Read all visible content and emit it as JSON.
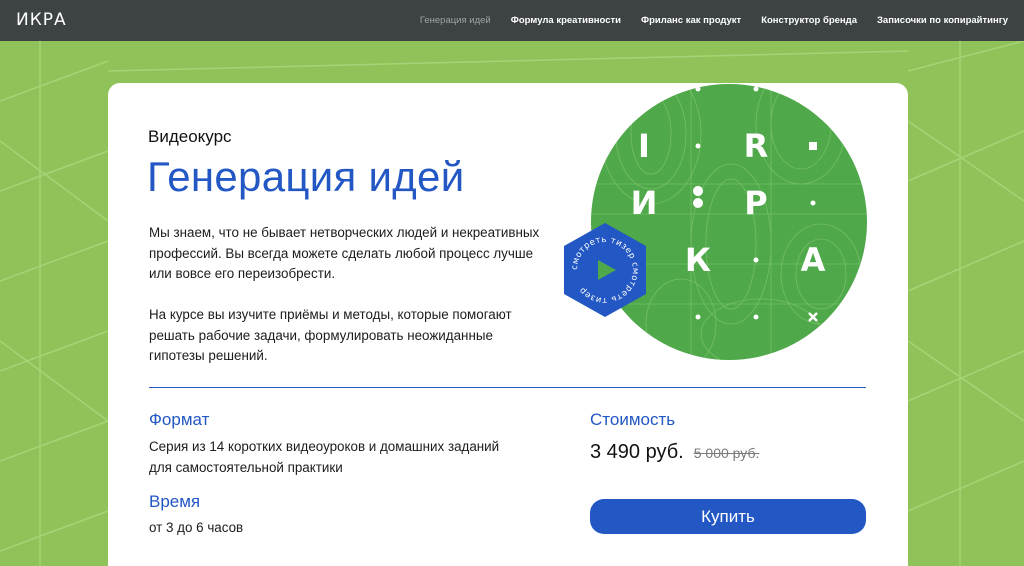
{
  "header": {
    "logo": "ИКРА",
    "nav": [
      {
        "label": "Генерация идей",
        "active": true
      },
      {
        "label": "Формула креативности",
        "active": false
      },
      {
        "label": "Фриланс как продукт",
        "active": false
      },
      {
        "label": "Конструктор бренда",
        "active": false
      },
      {
        "label": "Записочки по копирайтингу",
        "active": false
      }
    ]
  },
  "course": {
    "eyebrow": "Видеокурс",
    "title": "Генерация идей",
    "description_1": "Мы знаем, что не бывает нетворческих людей и некреативных профессий. Вы всегда можете сделать любой процесс лучше или вовсе его переизобрести.",
    "description_2": "На курсе вы изучите приёмы и методы, которые помогают решать рабочие задачи, формулировать неожиданные гипотезы решений."
  },
  "hero": {
    "letters": [
      "I",
      "R",
      "И",
      "Р",
      "К",
      "А"
    ],
    "teaser_label": "смотреть тизер смотреть тизер"
  },
  "details": {
    "format_title": "Формат",
    "format_text": "Серия из 14 коротких видеоуроков и домашних заданий для самостоятельной практики",
    "time_title": "Время",
    "time_text": "от 3 до 6 часов",
    "price_title": "Стоимость",
    "price_current": "3 490 руб.",
    "price_old": "5 000 руб.",
    "buy_label": "Купить"
  },
  "colors": {
    "background_green": "#8fc35a",
    "nav_dark": "#3d4344",
    "accent_blue": "#2257c4",
    "hero_green": "#4fa84a"
  }
}
